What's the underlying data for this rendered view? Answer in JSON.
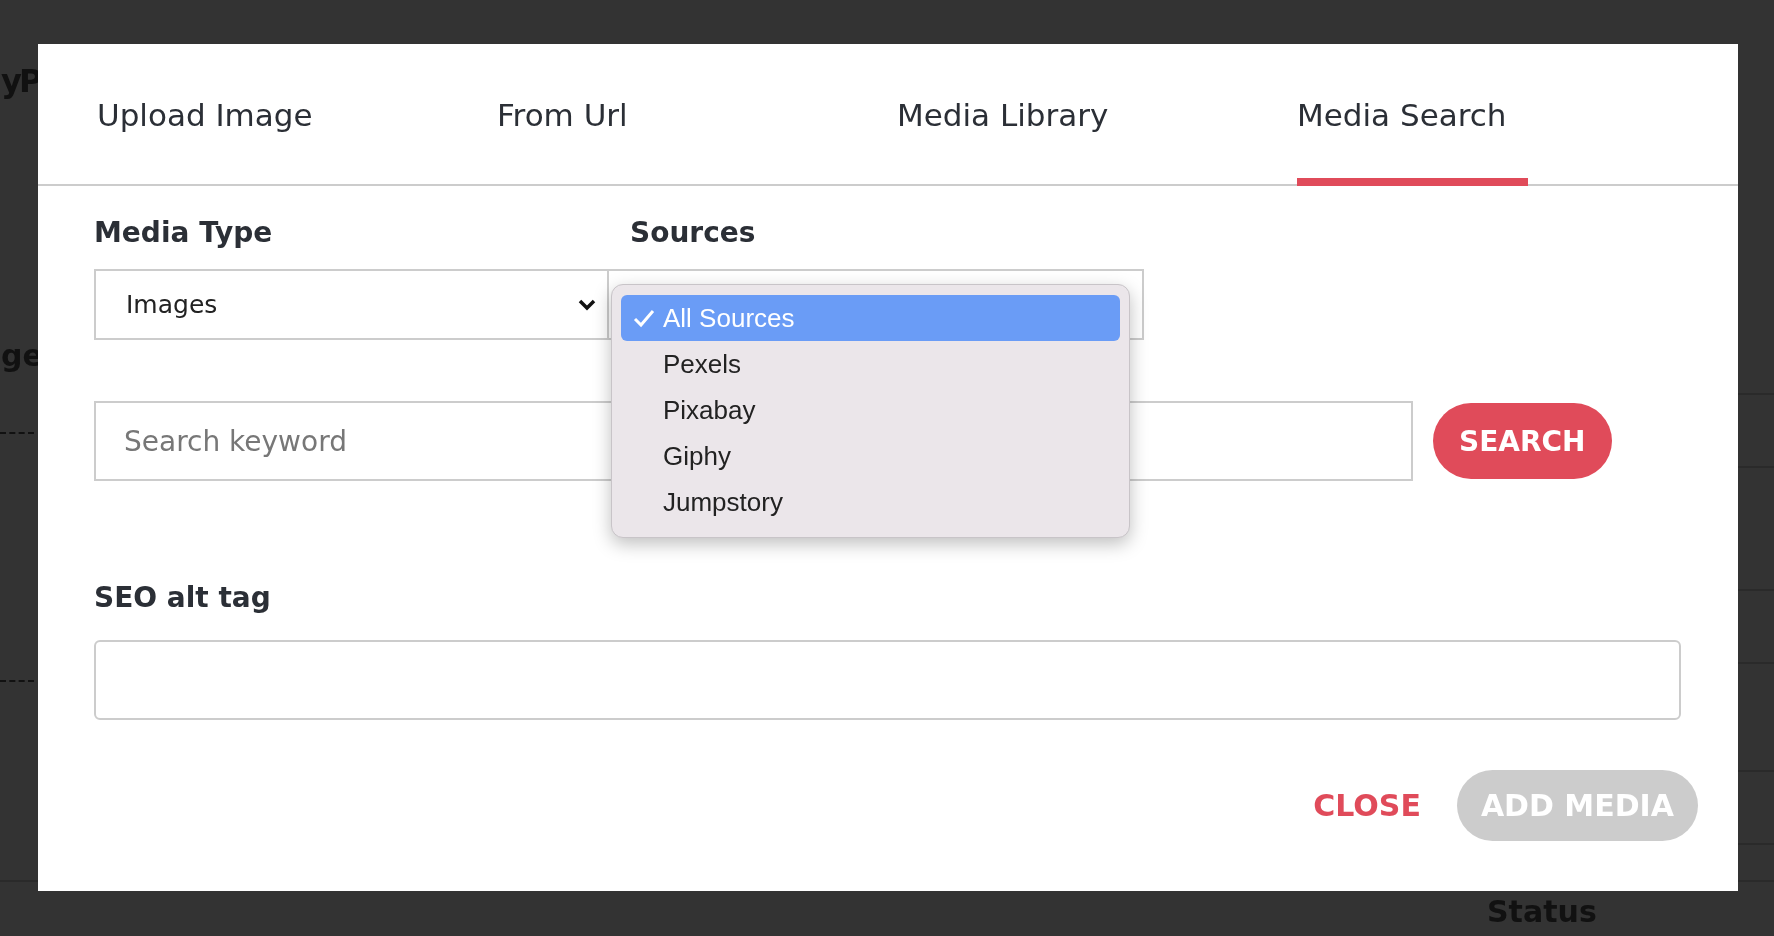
{
  "background": {
    "texts": [
      {
        "text": "y"
      },
      {
        "text": "P"
      },
      {
        "text": "ge"
      },
      {
        "text": "Status"
      }
    ]
  },
  "dialog": {
    "tabs": [
      {
        "label": "Upload Image",
        "selected": false
      },
      {
        "label": "From Url",
        "selected": false
      },
      {
        "label": "Media Library",
        "selected": false
      },
      {
        "label": "Media Search",
        "selected": true
      }
    ],
    "media_type": {
      "label": "Media Type",
      "value": "Images"
    },
    "sources": {
      "label": "Sources",
      "options": [
        {
          "label": "All Sources",
          "selected": true
        },
        {
          "label": "Pexels",
          "selected": false
        },
        {
          "label": "Pixabay",
          "selected": false
        },
        {
          "label": "Giphy",
          "selected": false
        },
        {
          "label": "Jumpstory",
          "selected": false
        }
      ]
    },
    "search": {
      "placeholder": "Search keyword",
      "button": "SEARCH"
    },
    "seo_alt_tag": {
      "label": "SEO alt tag"
    },
    "buttons": [
      {
        "label": "CLOSE",
        "kind": "text",
        "disabled": false
      },
      {
        "label": "ADD MEDIA",
        "kind": "filled",
        "disabled": true
      }
    ]
  }
}
